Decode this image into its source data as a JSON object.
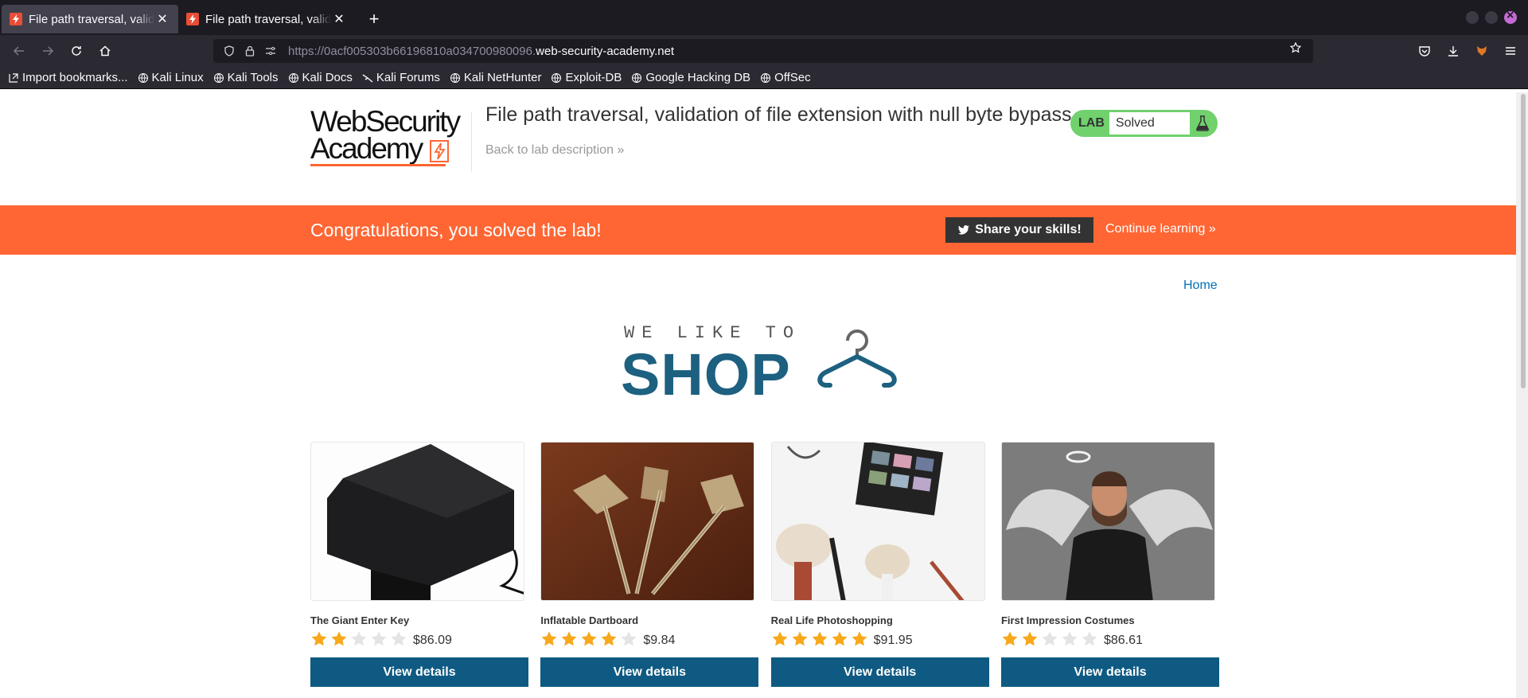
{
  "browser": {
    "tabs": [
      {
        "title": "File path traversal, validat",
        "active": true
      },
      {
        "title": "File path traversal, validat",
        "active": false
      }
    ],
    "url_dim": "https://0acf005303b66196810a034700980096.",
    "url_host": "web-security-academy.net",
    "bookmarks": [
      {
        "label": "Import bookmarks...",
        "icon": "import-icon"
      },
      {
        "label": "Kali Linux",
        "icon": "globe-icon"
      },
      {
        "label": "Kali Tools",
        "icon": "globe-icon"
      },
      {
        "label": "Kali Docs",
        "icon": "globe-icon"
      },
      {
        "label": "Kali Forums",
        "icon": "kali-dragon-icon"
      },
      {
        "label": "Kali NetHunter",
        "icon": "globe-icon"
      },
      {
        "label": "Exploit-DB",
        "icon": "globe-icon"
      },
      {
        "label": "Google Hacking DB",
        "icon": "globe-icon"
      },
      {
        "label": "OffSec",
        "icon": "globe-icon"
      }
    ]
  },
  "header": {
    "logo_line1": "WebSecurity",
    "logo_line2": "Academy",
    "lab_title": "File path traversal, validation of file extension with null byte bypass",
    "back_link": "Back to lab description",
    "lab_label": "LAB",
    "lab_status": "Solved"
  },
  "banner": {
    "congrats": "Congratulations, you solved the lab!",
    "share": "Share your skills!",
    "continue": "Continue learning"
  },
  "nav": {
    "home": "Home"
  },
  "shop_banner": {
    "top": "WE LIKE TO",
    "main": "SHOP"
  },
  "products": [
    {
      "name": "The Giant Enter Key",
      "rating": 2,
      "price": "$86.09",
      "button": "View details"
    },
    {
      "name": "Inflatable Dartboard",
      "rating": 4,
      "price": "$9.84",
      "button": "View details"
    },
    {
      "name": "Real Life Photoshopping",
      "rating": 5,
      "price": "$91.95",
      "button": "View details"
    },
    {
      "name": "First Impression Costumes",
      "rating": 2,
      "price": "$86.61",
      "button": "View details"
    }
  ],
  "colors": {
    "accent_orange": "#ff6633",
    "button_blue": "#0e5a82",
    "lab_green": "#70d16d",
    "star_filled": "#f7a81b",
    "star_empty": "#e4e4e4"
  }
}
